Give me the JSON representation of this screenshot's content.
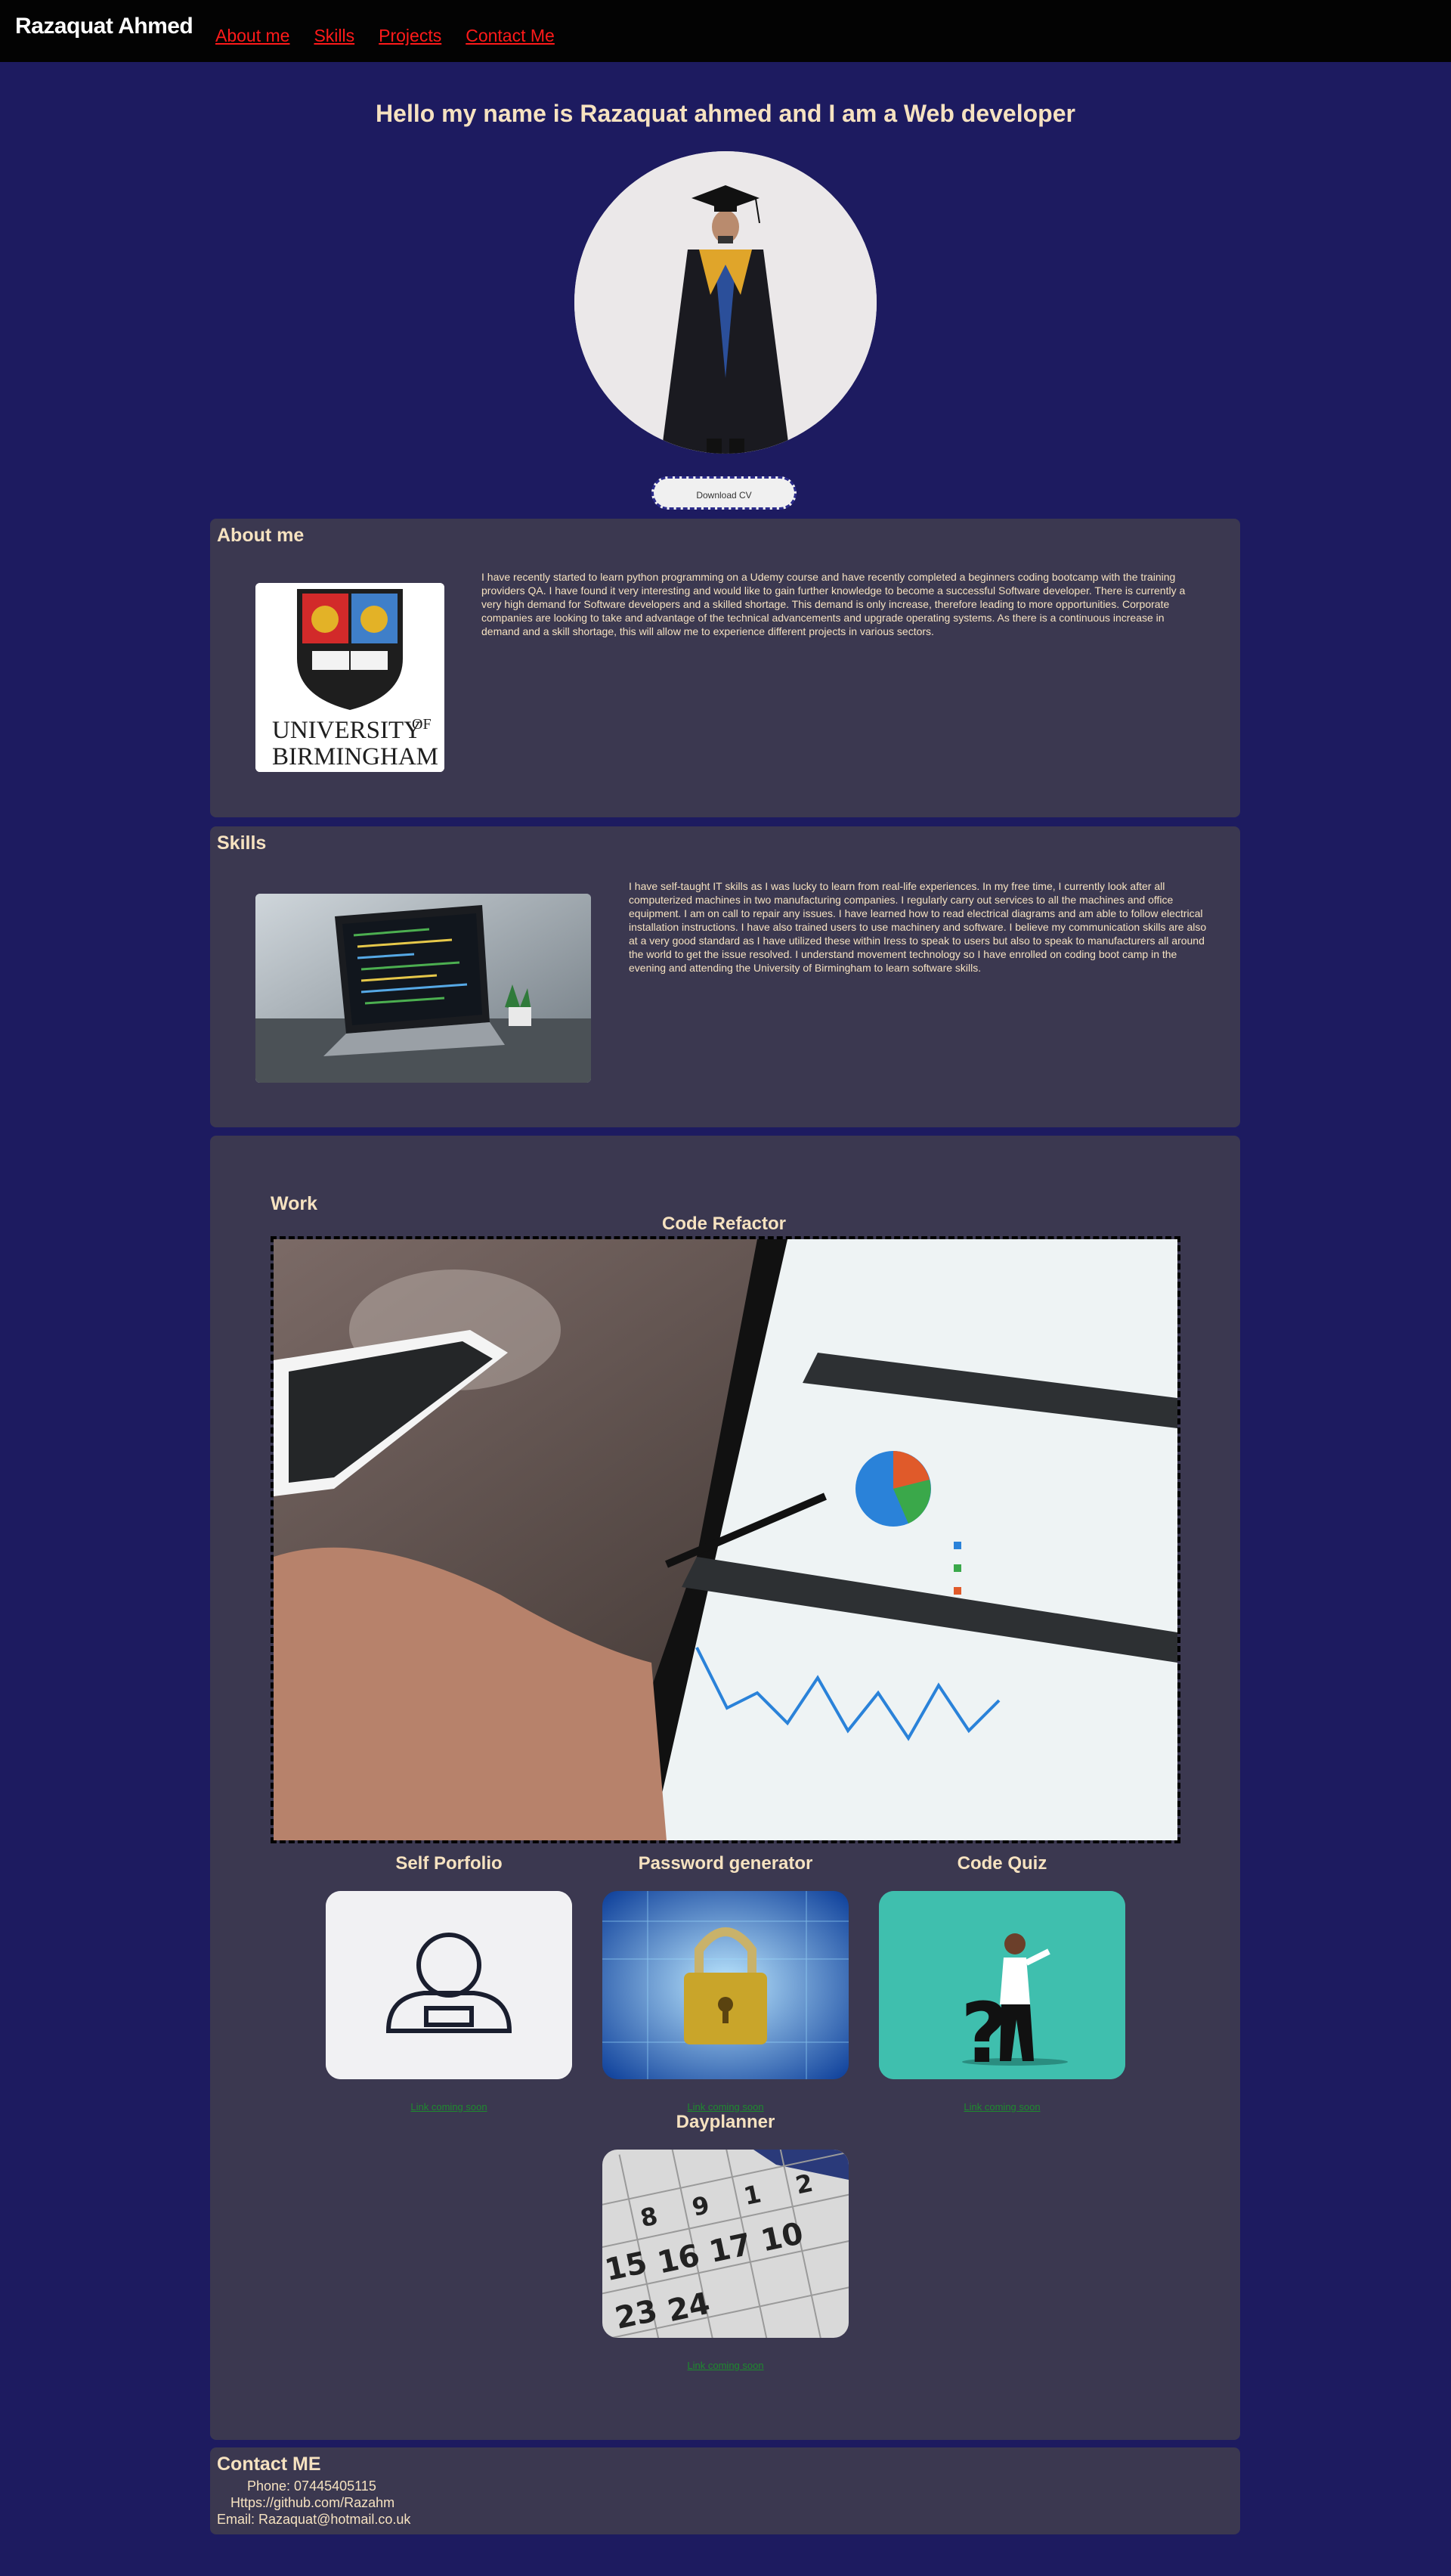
{
  "header": {
    "brand": "Razaquat Ahmed",
    "nav": [
      "About me",
      "Skills",
      "Projects",
      "Contact Me"
    ]
  },
  "hero": {
    "title": "Hello my name is Razaquat ahmed and I am a Web developer",
    "cv_button": "Download CV"
  },
  "about": {
    "title": "About me",
    "logo_text": [
      "UNIVERSITY",
      "OF",
      "BIRMINGHAM"
    ],
    "text": "I have recently started to learn python programming on a Udemy course and have recently completed a beginners coding bootcamp with the training providers QA. I have found it very interesting and would like to gain further knowledge to become a successful Software developer. There is currently a very high demand for Software developers and a skilled shortage. This demand is only increase, therefore leading to more opportunities. Corporate companies are looking to take and advantage of the technical advancements and upgrade operating systems. As there is a continuous increase in demand and a skill shortage, this will allow me to experience different projects in various sectors."
  },
  "skills": {
    "title": "Skills",
    "text": "I have self-taught IT skills as I was lucky to learn from real-life experiences. In my free time, I currently look after all computerized machines in two manufacturing companies. I regularly carry out services to all the machines and office equipment. I am on call to repair any issues. I have learned how to read electrical diagrams and am able to follow electrical installation instructions. I have also trained users to use machinery and software. I believe my communication skills are also at a very good standard as I have utilized these within Iress to speak to users but also to speak to manufacturers all around the world to get the issue resolved. I understand movement technology so I have enrolled on coding boot camp in the evening and attending the University of Birmingham to learn software skills."
  },
  "work": {
    "title": "Work",
    "featured": "Code Refactor",
    "projects": [
      {
        "title": "Self Porfolio",
        "link": "Link coming soon"
      },
      {
        "title": "Password generator",
        "link": "Link coming soon"
      },
      {
        "title": "Code Quiz",
        "link": "Link coming soon"
      },
      {
        "title": "Dayplanner",
        "link": "Link coming soon"
      }
    ]
  },
  "contact": {
    "title": "Contact ME",
    "phone": "Phone: 07445405115",
    "github": "Https://github.com/Razahm",
    "email": "Email: Razaquat@hotmail.co.uk"
  },
  "colors": {
    "background": "#1d1b60",
    "card": "#3b3850",
    "text": "#f6e2c0",
    "nav_link": "#ff1a1a",
    "project_link": "#1e8a2e"
  }
}
